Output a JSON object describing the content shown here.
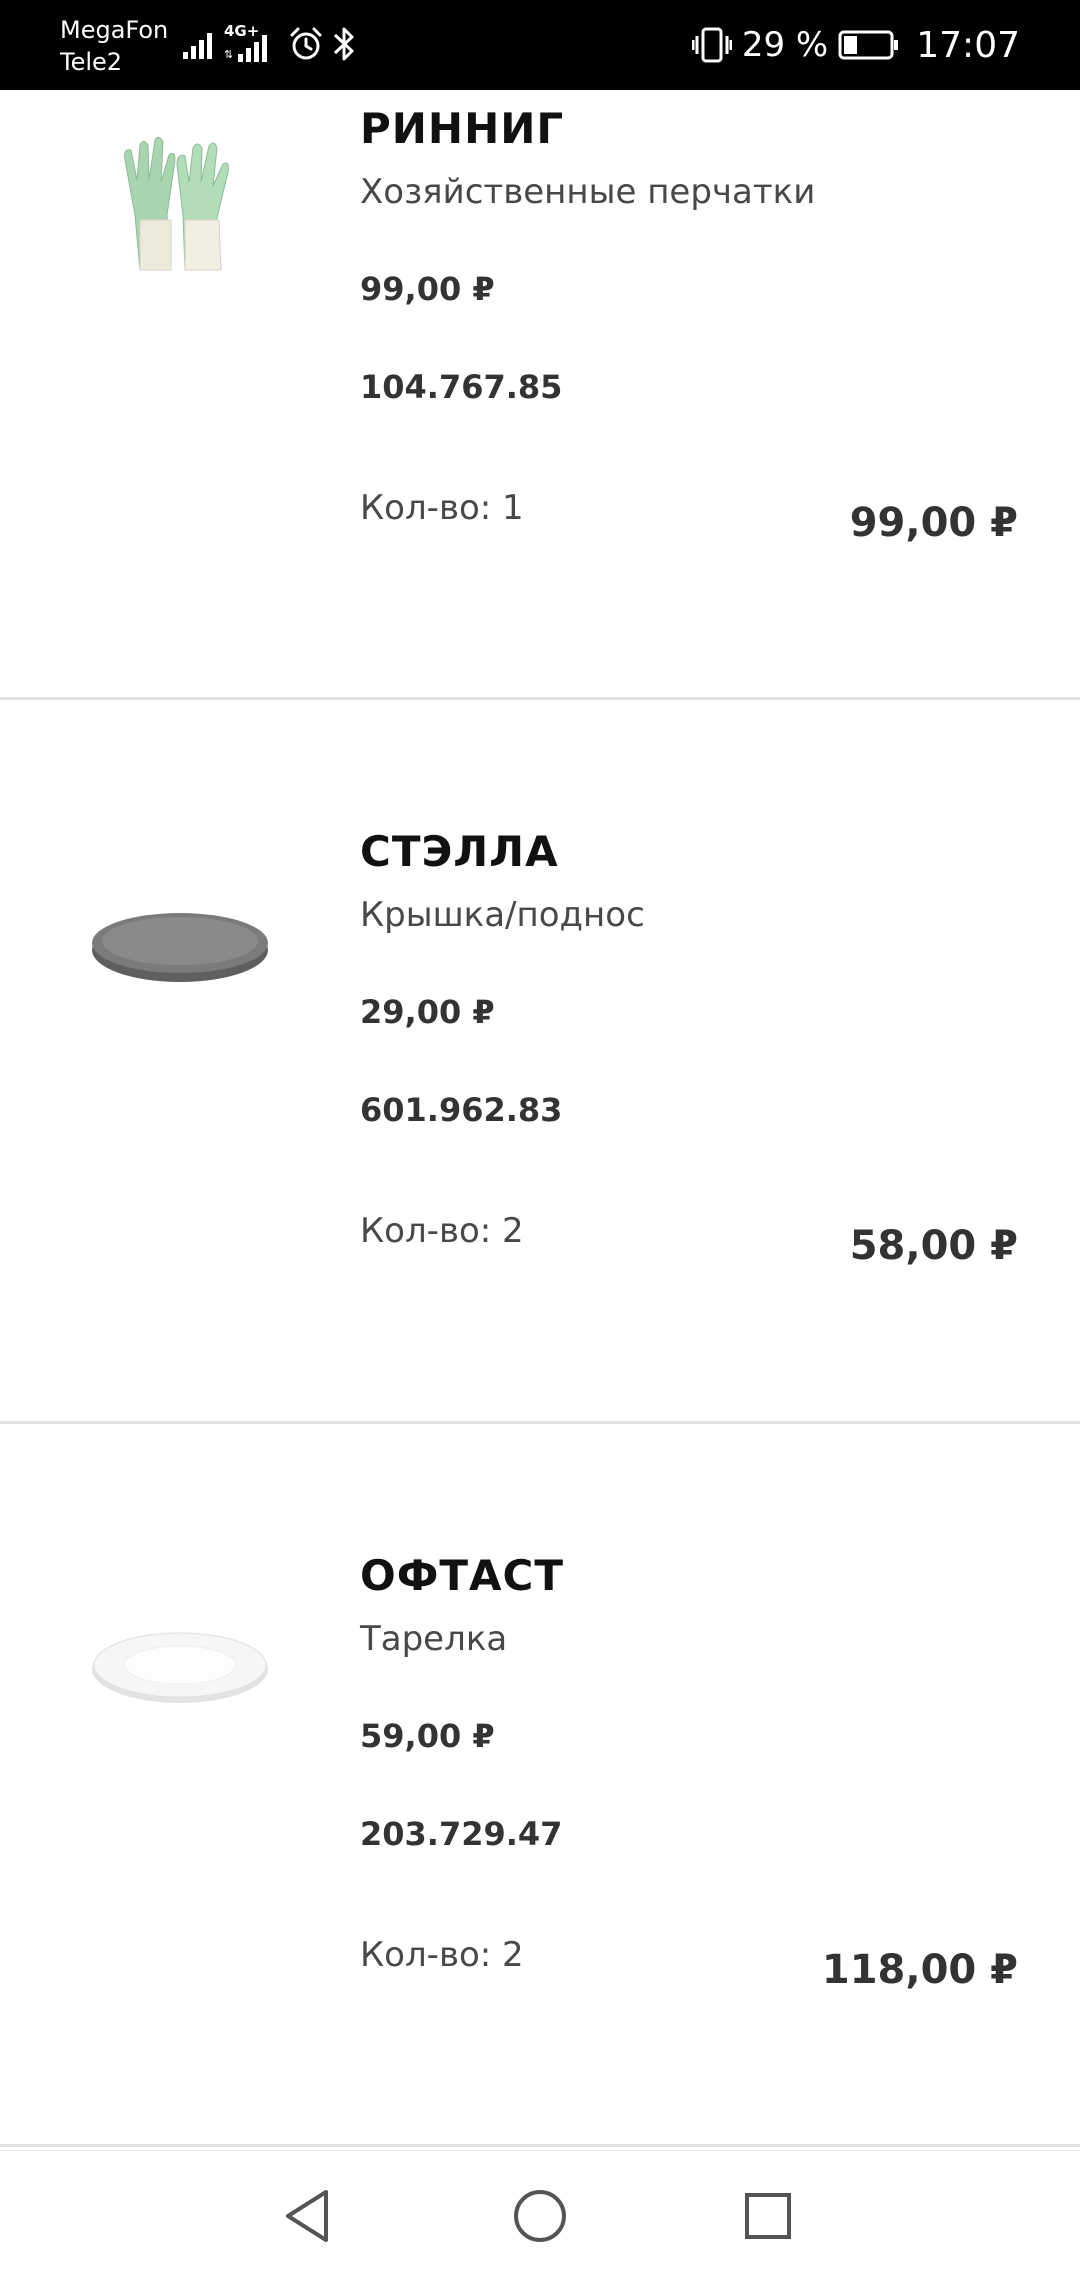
{
  "status_bar": {
    "carrier_1": "MegaFon",
    "carrier_2": "Tele2",
    "network_label": "4G+",
    "battery_percent": "29 %",
    "battery_level": 0.29,
    "time": "17:07",
    "icons": [
      "signal-icon",
      "signal-4g-icon",
      "alarm-icon",
      "bluetooth-icon",
      "vibrate-icon",
      "battery-icon"
    ]
  },
  "products": [
    {
      "name": "РИННИГ",
      "description": "Хозяйственные перчатки",
      "unit_price": "99,00 ₽",
      "article": "104.767.85",
      "quantity": "Кол-во: 1",
      "total": "99,00 ₽",
      "image": "rubber-gloves-image"
    },
    {
      "name": "СТЭЛЛА",
      "description": "Крышка/поднос",
      "unit_price": "29,00 ₽",
      "article": "601.962.83",
      "quantity": "Кол-во: 2",
      "total": "58,00 ₽",
      "image": "grey-lid-tray-image"
    },
    {
      "name": "ОФТАСТ",
      "description": "Тарелка",
      "unit_price": "59,00 ₽",
      "article": "203.729.47",
      "quantity": "Кол-во: 2",
      "total": "118,00 ₽",
      "image": "white-plate-image"
    }
  ],
  "nav_bar": {
    "buttons": [
      "back-icon",
      "home-icon",
      "recents-icon"
    ]
  }
}
